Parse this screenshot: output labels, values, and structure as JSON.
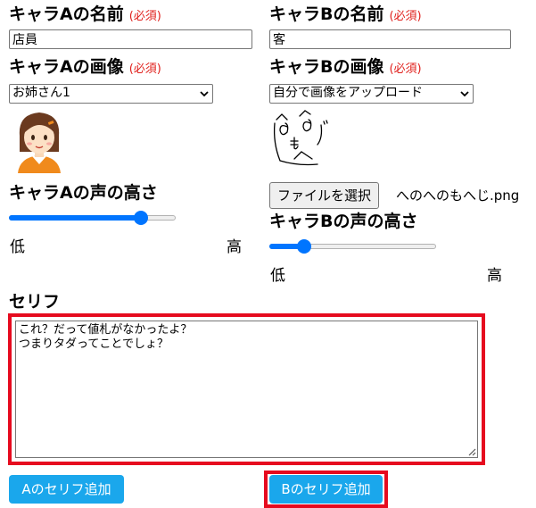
{
  "chara_a": {
    "name_label": "キャラAの名前",
    "name_required": "(必須)",
    "name_value": "店員",
    "image_label": "キャラAの画像",
    "image_required": "(必須)",
    "image_selected": "お姉さん1",
    "voice_label": "キャラAの声の高さ",
    "voice_low": "低",
    "voice_high": "高",
    "voice_level": 0.82
  },
  "chara_b": {
    "name_label": "キャラBの名前",
    "name_required": "(必須)",
    "name_value": "客",
    "image_label": "キャラBの画像",
    "image_required": "(必須)",
    "image_selected": "自分で画像をアップロード",
    "file_button": "ファイルを選択",
    "file_name": "へのへのもへじ.png",
    "voice_label": "キャラBの声の高さ",
    "voice_low": "低",
    "voice_high": "高",
    "voice_level": 0.18
  },
  "serif": {
    "label": "セリフ",
    "line1": "これ？だって値札がなかったよ？",
    "line2": "つまりタダってことでしょ？"
  },
  "buttons": {
    "add_a": "Aのセリフ追加",
    "add_b": "Bのセリフ追加"
  },
  "colors": {
    "accent_blue": "#0075ff",
    "button_blue": "#1aa7ec",
    "required_red": "#e0201c",
    "highlight_red": "#e60b1f"
  },
  "icons": {
    "avatar_a": "girl-avatar-icon",
    "avatar_b": "henohenomoheji-face-icon"
  }
}
